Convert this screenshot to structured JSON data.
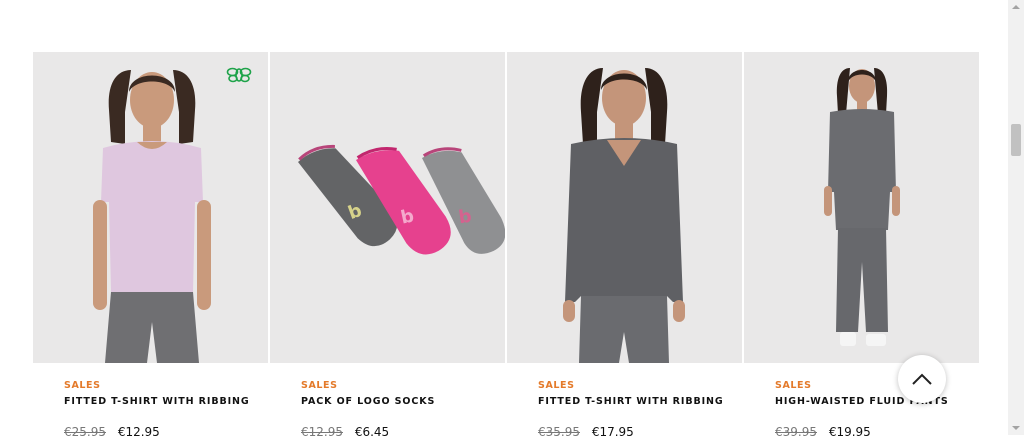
{
  "products": [
    {
      "tag": "SALES",
      "title": "FITTED T-SHIRT WITH RIBBING",
      "old_price": "€25.95",
      "new_price": "€12.95",
      "image": "model-pink-ribbed-tshirt",
      "eco_badge": "bee-icon"
    },
    {
      "tag": "SALES",
      "title": "PACK OF LOGO SOCKS",
      "old_price": "€12.95",
      "new_price": "€6.45",
      "image": "three-ankle-socks"
    },
    {
      "tag": "SALES",
      "title": "FITTED T-SHIRT WITH RIBBING",
      "old_price": "€35.95",
      "new_price": "€17.95",
      "image": "model-grey-vneck-longsleeve"
    },
    {
      "tag": "SALES",
      "title": "HIGH-WAISTED FLUID PANTS",
      "old_price": "€39.95",
      "new_price": "€19.95",
      "image": "model-grey-tunic-wide-pants"
    }
  ],
  "scroll_top_button": {
    "icon": "chevron-up-icon"
  },
  "colors": {
    "sale_tag": "#e47a2a",
    "image_bg": "#e9e8e8",
    "eco_badge": "#1fa34a"
  }
}
